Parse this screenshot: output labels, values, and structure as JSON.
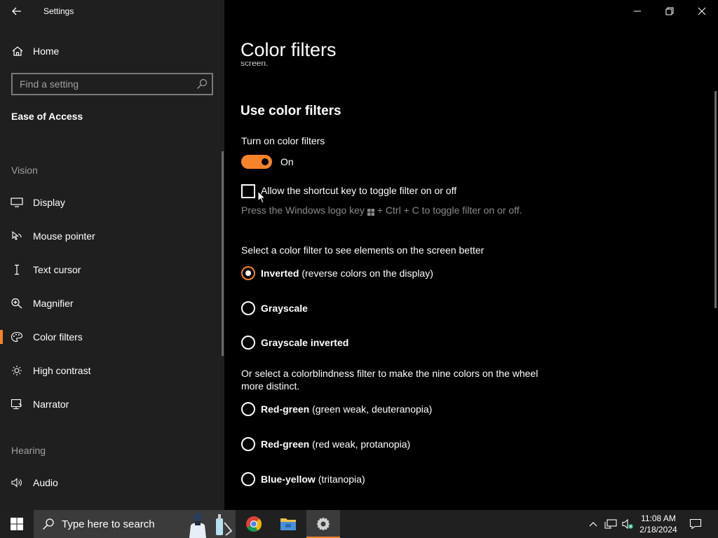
{
  "window": {
    "title": "Settings"
  },
  "sidebar": {
    "home_label": "Home",
    "search_placeholder": "Find a setting",
    "section_title": "Ease of Access",
    "groups": {
      "vision": "Vision",
      "hearing": "Hearing"
    },
    "items": [
      {
        "label": "Display",
        "icon": "monitor-icon"
      },
      {
        "label": "Mouse pointer",
        "icon": "mouse-pointer-icon"
      },
      {
        "label": "Text cursor",
        "icon": "text-cursor-icon"
      },
      {
        "label": "Magnifier",
        "icon": "magnifier-icon"
      },
      {
        "label": "Color filters",
        "icon": "palette-icon",
        "active": true
      },
      {
        "label": "High contrast",
        "icon": "sun-contrast-icon"
      },
      {
        "label": "Narrator",
        "icon": "narrator-icon"
      },
      {
        "label": "Audio",
        "icon": "speaker-icon"
      }
    ]
  },
  "main": {
    "title": "Color filters",
    "cut_text": "screen.",
    "section_heading": "Use color filters",
    "toggle": {
      "label": "Turn on color filters",
      "state": "On",
      "on": true
    },
    "shortcut_checkbox": {
      "label": "Allow the shortcut key to toggle filter on or off",
      "checked": false
    },
    "shortcut_hint_before": "Press the Windows logo key",
    "shortcut_hint_after": "+ Ctrl + C to toggle filter on or off.",
    "filter_prompt": "Select a color filter to see elements on the screen better",
    "filters": [
      {
        "name": "Inverted",
        "desc": "(reverse colors on the display)",
        "selected": true
      },
      {
        "name": "Grayscale",
        "desc": "",
        "selected": false
      },
      {
        "name": "Grayscale inverted",
        "desc": "",
        "selected": false
      }
    ],
    "colorblind_prompt_line1": "Or select a colorblindness filter to make the nine colors on the wheel",
    "colorblind_prompt_line2": "more distinct.",
    "colorblind_filters": [
      {
        "name": "Red-green",
        "desc": "(green weak, deuteranopia)",
        "selected": false
      },
      {
        "name": "Red-green",
        "desc": "(red weak, protanopia)",
        "selected": false
      },
      {
        "name": "Blue-yellow",
        "desc": "(tritanopia)",
        "selected": false
      }
    ]
  },
  "taskbar": {
    "search_placeholder": "Type here to search",
    "time": "11:08 AM",
    "date": "2/18/2024",
    "apps": [
      "chrome-icon",
      "file-explorer-icon",
      "settings-gear-icon"
    ]
  },
  "colors": {
    "accent": "#f7842b",
    "sidebar_bg": "#1f1f1f",
    "main_bg": "#000000",
    "taskbar_bg": "#202020"
  }
}
